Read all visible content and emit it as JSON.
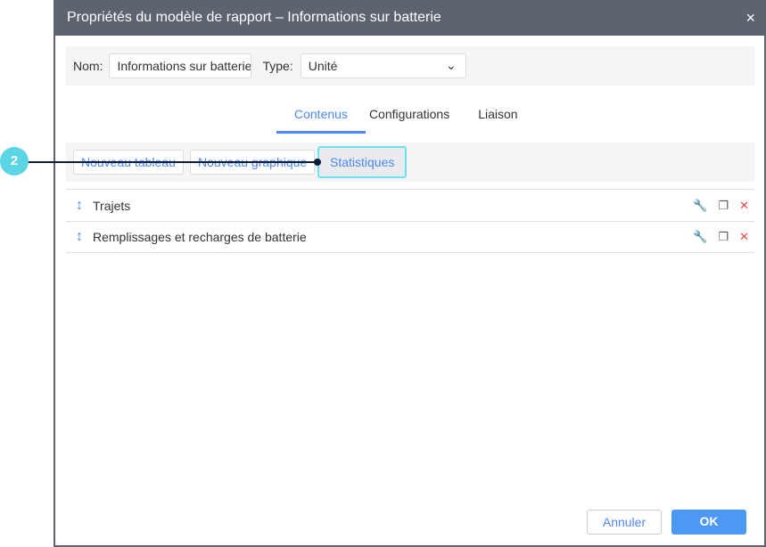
{
  "dialog": {
    "title": "Propriétés du modèle de rapport – Informations sur batterie",
    "close_icon": "×"
  },
  "props": {
    "name_label": "Nom:",
    "name_value": "Informations sur batterie",
    "type_label": "Type:",
    "type_value": "Unité"
  },
  "tabs": [
    "Contenus",
    "Configurations",
    "Liaison"
  ],
  "toolbar": {
    "new_table": "Nouveau tableau",
    "new_chart": "Nouveau graphique",
    "statistics": "Statistiques"
  },
  "rows": [
    {
      "label": "Trajets"
    },
    {
      "label": "Remplissages et recharges de batterie"
    }
  ],
  "footer": {
    "cancel": "Annuler",
    "ok": "OK"
  },
  "callout": {
    "number": "2"
  }
}
